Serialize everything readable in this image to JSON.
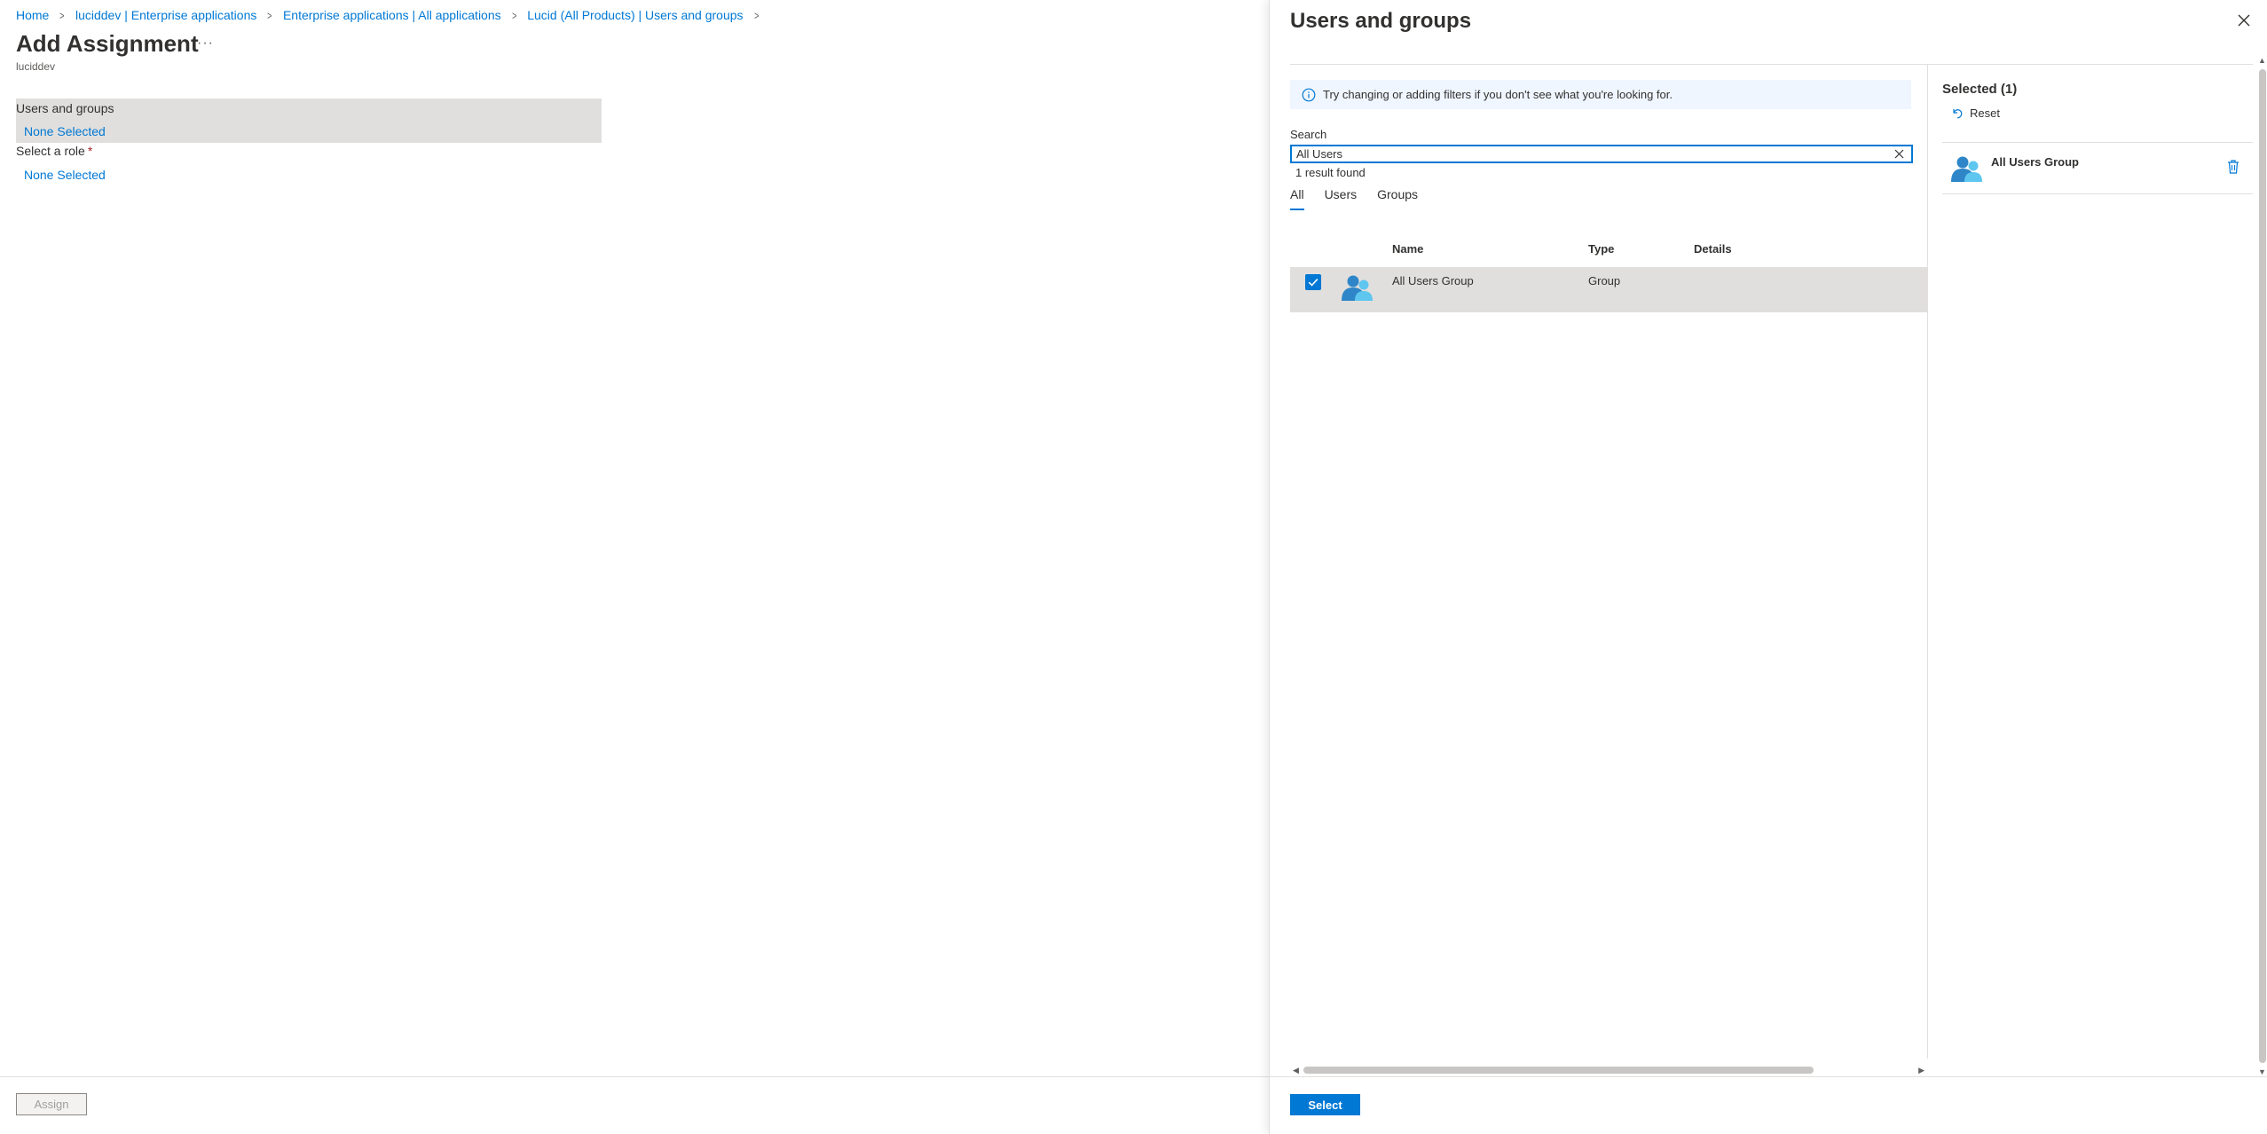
{
  "breadcrumb": {
    "items": [
      "Home",
      "luciddev | Enterprise applications",
      "Enterprise applications | All applications",
      "Lucid (All Products) | Users and groups"
    ]
  },
  "page": {
    "title": "Add Assignment",
    "more_label": "···",
    "subtitle": "luciddev"
  },
  "assignment": {
    "users_groups_label": "Users and groups",
    "users_groups_value": "None Selected",
    "role_label": "Select a role",
    "role_required": "*",
    "role_value": "None Selected"
  },
  "left_footer": {
    "assign_label": "Assign"
  },
  "panel": {
    "title": "Users and groups",
    "info_text": "Try changing or adding filters if you don't see what you're looking for.",
    "search_label": "Search",
    "search_value": "All Users",
    "result_count": "1 result found",
    "tabs": [
      {
        "label": "All",
        "active": true
      },
      {
        "label": "Users",
        "active": false
      },
      {
        "label": "Groups",
        "active": false
      }
    ],
    "columns": [
      "Name",
      "Type",
      "Details"
    ],
    "rows": [
      {
        "name": "All Users Group",
        "type": "Group",
        "details": "",
        "checked": true
      }
    ],
    "selected_title": "Selected (1)",
    "reset_label": "Reset",
    "selected_items": [
      {
        "name": "All Users Group"
      }
    ],
    "select_label": "Select"
  },
  "colors": {
    "accent": "#0078d4",
    "row_selected": "#e1dfdd",
    "info_bg": "#f0f6ff"
  }
}
